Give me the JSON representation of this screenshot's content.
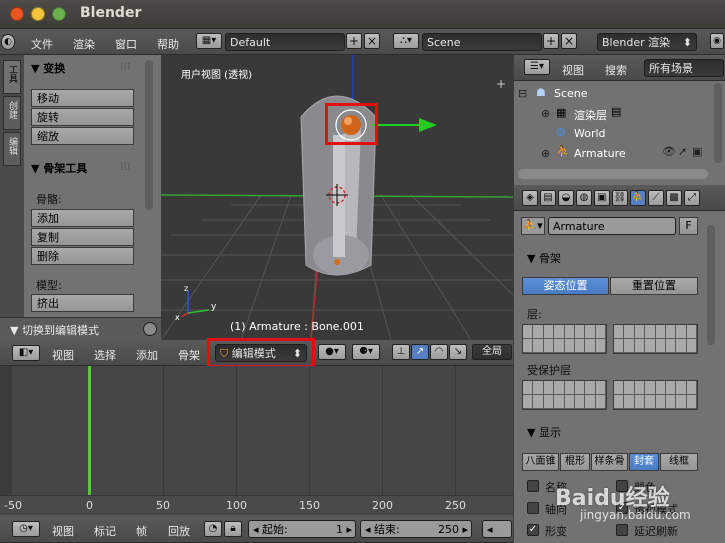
{
  "window": {
    "title": "Blender"
  },
  "info_header": {
    "menus": [
      "文件",
      "渲染",
      "窗口",
      "帮助"
    ],
    "layout": "Default",
    "scene": "Scene",
    "engine": "Blender 渲染"
  },
  "tool_shelf": {
    "tabs": [
      "工具",
      "创建",
      "编辑"
    ],
    "transform": {
      "title": "▼ 变换",
      "buttons": [
        "移动",
        "旋转",
        "缩放"
      ]
    },
    "armature_tools": {
      "title": "▼ 骨架工具",
      "bones_label": "骨骼:",
      "bones_buttons": [
        "添加",
        "复制",
        "删除"
      ],
      "model_label": "模型:",
      "model_buttons": [
        "挤出"
      ]
    },
    "operator_panel": "▼ 切换到编辑模式"
  },
  "viewport": {
    "label": "用户视图 (透视)",
    "status": "(1) Armature : Bone.001",
    "axis_x": "x",
    "axis_y": "y",
    "axis_z": "z"
  },
  "view3d_header": {
    "menus": [
      "视图",
      "选择",
      "添加",
      "骨架"
    ],
    "mode": "编辑模式",
    "global": "全局"
  },
  "timeline": {
    "ticks": [
      "-50",
      "0",
      "50",
      "100",
      "150",
      "200",
      "250"
    ],
    "current_frame": "0"
  },
  "timeline_header": {
    "menus": [
      "视图",
      "标记",
      "帧",
      "回放"
    ],
    "start_label": "起始:",
    "start": "1",
    "end_label": "结束:",
    "end": "250"
  },
  "outliner": {
    "menus": [
      "视图",
      "搜索"
    ],
    "filter": "所有场景",
    "items": [
      "Scene",
      "渲染层",
      "World",
      "Armature"
    ]
  },
  "properties": {
    "datablock": "Armature",
    "fake": "F",
    "skeleton": {
      "title": "▼ 骨架",
      "pose_position": "姿态位置",
      "rest_position": "重置位置",
      "layers_label": "层:",
      "protected_label": "受保护层"
    },
    "display": {
      "title": "▼ 显示",
      "types": [
        "八面锥",
        "棍形",
        "样条骨",
        "封套",
        "线框"
      ],
      "active_type": "封套",
      "options": [
        "名称",
        "轴向",
        "形变"
      ],
      "options_right": [
        "颜色",
        "透视模式",
        "延迟刷新"
      ]
    }
  },
  "watermark": {
    "text": "Baidu经验",
    "url": "jingyan.baidu.com"
  },
  "colors": {
    "accent": "#5680c2",
    "red_highlight": "#e01010",
    "green_axis": "#22cc22",
    "red_axis": "#d03030",
    "timeline_frame": "#57c83a"
  }
}
